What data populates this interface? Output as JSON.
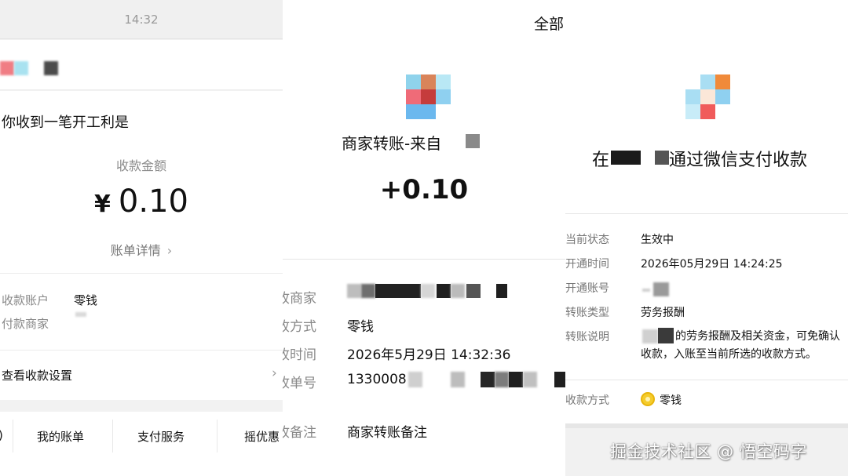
{
  "panel1": {
    "status_time": "14:32",
    "title": "你收到一笔开工利是",
    "amount_label": "收款金额",
    "currency": "¥",
    "amount": "0.10",
    "bill_details": "账单详情",
    "receiving_account_label": "收款账户",
    "receiving_account_value": "零钱",
    "payer_label": "付款商家",
    "settings_label": "查看收款设置",
    "bottom_tabs": [
      "我的账单",
      "支付服务",
      "摇优惠"
    ]
  },
  "panel2": {
    "top_label": "全部",
    "merchant_title": "商家转账-来自",
    "amount": "+0.10",
    "rows": [
      {
        "label": "收商家",
        "value": ""
      },
      {
        "label": "收方式",
        "value": "零钱"
      },
      {
        "label": "收时间",
        "value": "2026年5月29日 14:32:36"
      },
      {
        "label": "收单号",
        "value": "1330008"
      },
      {
        "label": "收备注",
        "value": "商家转账备注"
      }
    ]
  },
  "panel3": {
    "title_prefix": "在",
    "title_suffix": "通过微信支付收款",
    "rows": [
      {
        "label": "当前状态",
        "value": "生效中"
      },
      {
        "label": "开通时间",
        "value": "2026年05月29日 14:24:25"
      },
      {
        "label": "开通账号",
        "value": ""
      },
      {
        "label": "转账类型",
        "value": "劳务报酬"
      },
      {
        "label": "转账说明",
        "value": ""
      }
    ],
    "description": "的劳务报酬及相关资金，可免确认收款，入账至当前所选的收款方式。",
    "method_label": "收款方式",
    "method_value": "零钱"
  },
  "watermark": "掘金技术社区 @ 悟空码字",
  "colors": {
    "coin": "#f5cc2c",
    "muted_text": "#888888",
    "divider": "#e6e6e6"
  },
  "icons": [
    "merchant-logo-icon",
    "wechat-pay-coin-icon",
    "chevron-right-icon"
  ]
}
